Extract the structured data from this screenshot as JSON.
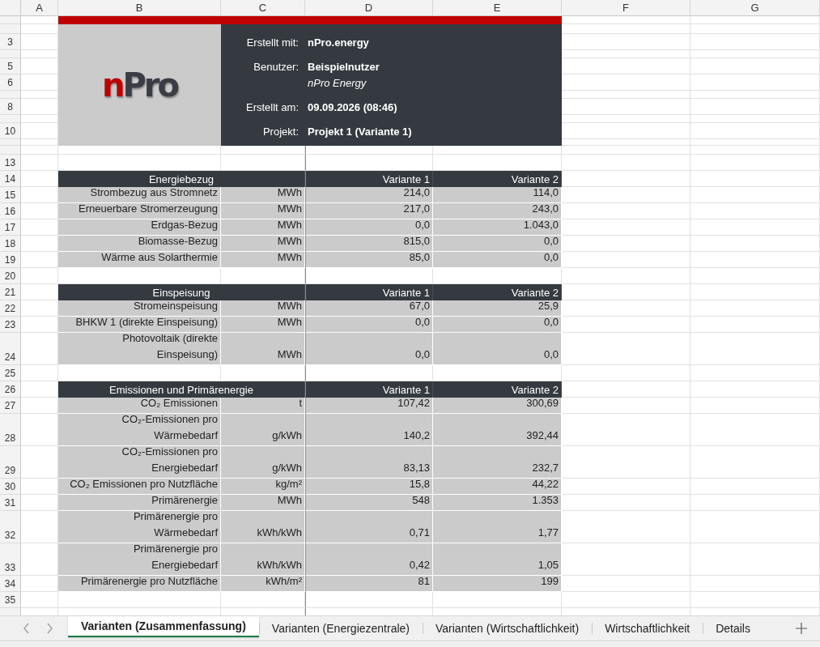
{
  "columns": [
    "A",
    "B",
    "C",
    "D",
    "E",
    "F",
    "G"
  ],
  "row_numbers": [
    "3",
    "5",
    "6",
    "8",
    "10",
    "13",
    "14",
    "15",
    "16",
    "17",
    "18",
    "19",
    "20",
    "21",
    "22",
    "23",
    "24",
    "25",
    "26",
    "27",
    "28",
    "29",
    "30",
    "31",
    "32",
    "33",
    "34",
    "35"
  ],
  "logo": {
    "text": "nPro"
  },
  "info": [
    {
      "label": "Erstellt mit:",
      "values": [
        {
          "text": "nPro.energy",
          "kind": "bold"
        }
      ]
    },
    {
      "label": "Benutzer:",
      "values": [
        {
          "text": "Beispielnutzer",
          "kind": "bold"
        },
        {
          "text": "nPro Energy",
          "kind": "italic"
        }
      ]
    },
    {
      "label": "Erstellt am:",
      "values": [
        {
          "text": "09.09.2026 (08:46)",
          "kind": "bold"
        }
      ]
    },
    {
      "label": "Projekt:",
      "values": [
        {
          "text": "Projekt 1 (Variante 1)",
          "kind": "bold"
        }
      ]
    }
  ],
  "sections": [
    {
      "title": "Energiebezug",
      "columns": [
        "Variante 1",
        "Variante 2"
      ],
      "rows": [
        {
          "label": [
            "Strombezug aus Stromnetz"
          ],
          "unit": "MWh",
          "values": [
            "214,0",
            "114,0"
          ]
        },
        {
          "label": [
            "Erneuerbare Stromerzeugung"
          ],
          "unit": "MWh",
          "values": [
            "217,0",
            "243,0"
          ]
        },
        {
          "label": [
            "Erdgas-Bezug"
          ],
          "unit": "MWh",
          "values": [
            "0,0",
            "1.043,0"
          ]
        },
        {
          "label": [
            "Biomasse-Bezug"
          ],
          "unit": "MWh",
          "values": [
            "815,0",
            "0,0"
          ]
        },
        {
          "label": [
            "Wärme aus Solarthermie"
          ],
          "unit": "MWh",
          "values": [
            "85,0",
            "0,0"
          ]
        }
      ]
    },
    {
      "title": "Einspeisung",
      "columns": [
        "Variante 1",
        "Variante 2"
      ],
      "rows": [
        {
          "label": [
            "Stromeinspeisung"
          ],
          "unit": "MWh",
          "values": [
            "67,0",
            "25,9"
          ]
        },
        {
          "label": [
            "BHKW 1 (direkte Einspeisung)"
          ],
          "unit": "MWh",
          "values": [
            "0,0",
            "0,0"
          ]
        },
        {
          "label": [
            "Photovoltaik (direkte",
            "Einspeisung)"
          ],
          "unit": "MWh",
          "values": [
            "0,0",
            "0,0"
          ]
        }
      ]
    },
    {
      "title": "Emissionen und Primärenergie",
      "columns": [
        "Variante 1",
        "Variante 2"
      ],
      "rows": [
        {
          "label": [
            "CO₂ Emissionen"
          ],
          "unit": "t",
          "values": [
            "107,42",
            "300,69"
          ]
        },
        {
          "label": [
            "CO₂-Emissionen pro",
            "Wärmebedarf"
          ],
          "unit": "g/kWh",
          "values": [
            "140,2",
            "392,44"
          ]
        },
        {
          "label": [
            "CO₂-Emissionen pro",
            "Energiebedarf"
          ],
          "unit": "g/kWh",
          "values": [
            "83,13",
            "232,7"
          ]
        },
        {
          "label": [
            "CO₂ Emissionen pro Nutzfläche"
          ],
          "unit": "kg/m²",
          "values": [
            "15,8",
            "44,22"
          ]
        },
        {
          "label": [
            "Primärenergie"
          ],
          "unit": "MWh",
          "values": [
            "548",
            "1.353"
          ]
        },
        {
          "label": [
            "Primärenergie pro",
            "Wärmebedarf"
          ],
          "unit": "kWh/kWh",
          "values": [
            "0,71",
            "1,77"
          ]
        },
        {
          "label": [
            "Primärenergie pro",
            "Energiebedarf"
          ],
          "unit": "kWh/kWh",
          "values": [
            "0,42",
            "1,05"
          ]
        },
        {
          "label": [
            "Primärenergie pro Nutzfläche"
          ],
          "unit": "kWh/m²",
          "values": [
            "81",
            "199"
          ]
        }
      ]
    }
  ],
  "sheet_tabs": [
    {
      "label": "Varianten (Zusammenfassung)",
      "selected": true
    },
    {
      "label": "Varianten (Energiezentrale)",
      "selected": false
    },
    {
      "label": "Varianten (Wirtschaftlichkeit)",
      "selected": false
    },
    {
      "label": "Wirtschaftlichkeit",
      "selected": false
    },
    {
      "label": "Details",
      "selected": false
    }
  ]
}
